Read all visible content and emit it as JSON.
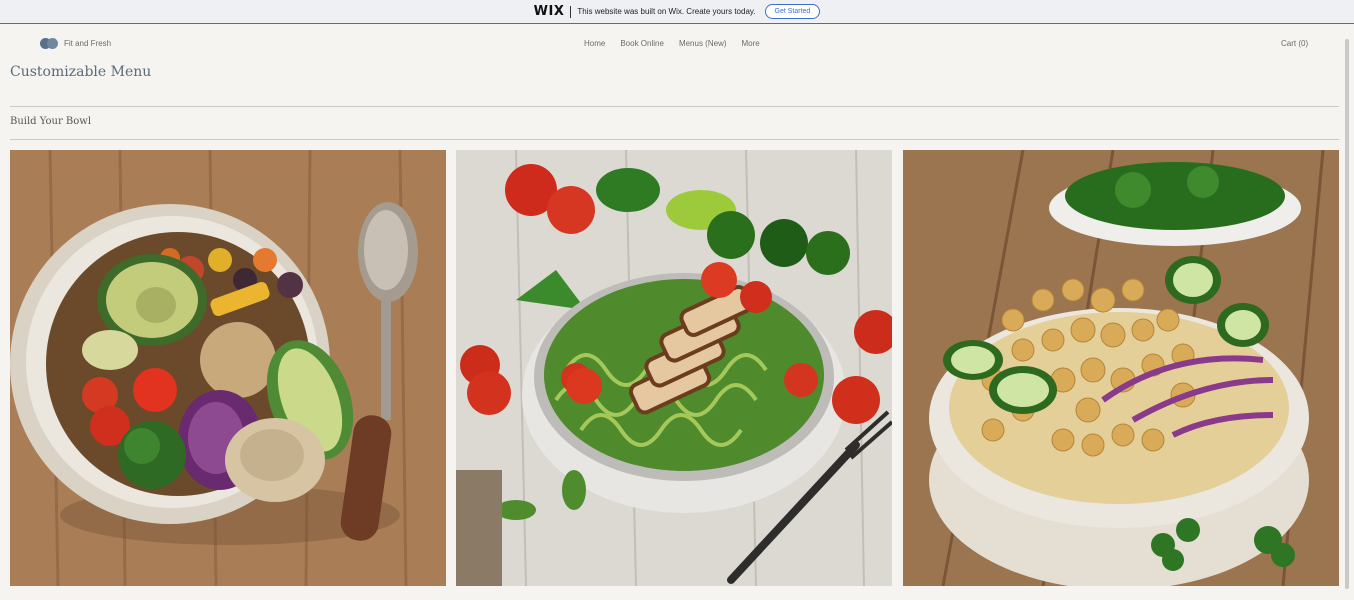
{
  "wix_banner": {
    "logo": "WIX",
    "message": "This website was built on Wix. Create yours today.",
    "cta_label": "Get Started"
  },
  "site": {
    "name": "Fit and Fresh",
    "nav": [
      "Home",
      "Book Online",
      "Menus (New)",
      "More"
    ],
    "cart_label": "Cart (0)"
  },
  "page": {
    "title": "Customizable Menu",
    "section_title": "Build Your Bowl"
  },
  "cards": [
    {
      "image": "buddha-bowl-photo"
    },
    {
      "image": "zucchini-noodle-chicken-bowl-photo"
    },
    {
      "image": "chickpea-salad-bowl-photo"
    }
  ]
}
